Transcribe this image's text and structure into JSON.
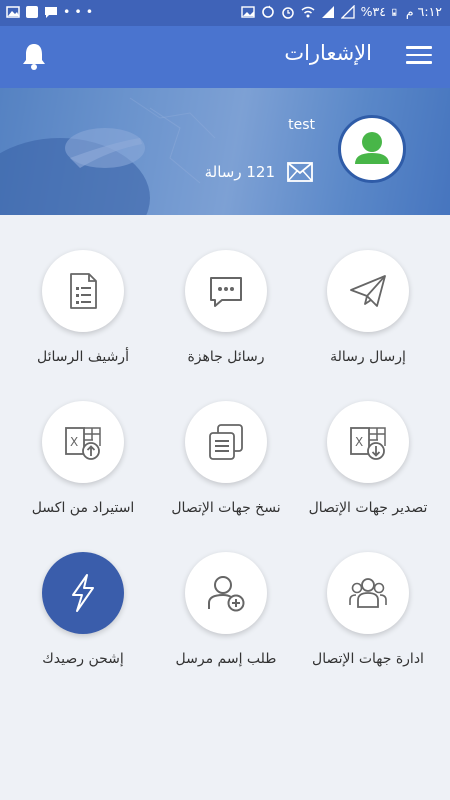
{
  "status_bar": {
    "time": "٦:١٢ م",
    "battery": "%٣٤"
  },
  "app_bar": {
    "title": "الإشعارات",
    "menu_icon": "hamburger-menu-icon",
    "bell_icon": "bell-icon"
  },
  "profile": {
    "username": "test",
    "message_count": "121 رسالة"
  },
  "colors": {
    "primary": "#4a74cf",
    "status": "#3f63b8",
    "accent_fill": "#3a5dab",
    "icon": "#666666"
  },
  "tiles": [
    {
      "label": "إرسال رسالة",
      "icon": "paper-plane-icon"
    },
    {
      "label": "رسائل جاهزة",
      "icon": "chat-bubble-icon"
    },
    {
      "label": "أرشيف الرسائل",
      "icon": "document-list-icon"
    },
    {
      "label": "تصدير جهات الإتصال",
      "icon": "excel-export-icon"
    },
    {
      "label": "نسخ جهات الإتصال",
      "icon": "copy-documents-icon"
    },
    {
      "label": "استيراد من اكسل",
      "icon": "excel-import-icon"
    },
    {
      "label": "ادارة جهات الإتصال",
      "icon": "group-users-icon"
    },
    {
      "label": "طلب إسم مرسل",
      "icon": "add-user-icon"
    },
    {
      "label": "إشحن رصيدك",
      "icon": "lightning-bolt-icon"
    }
  ]
}
